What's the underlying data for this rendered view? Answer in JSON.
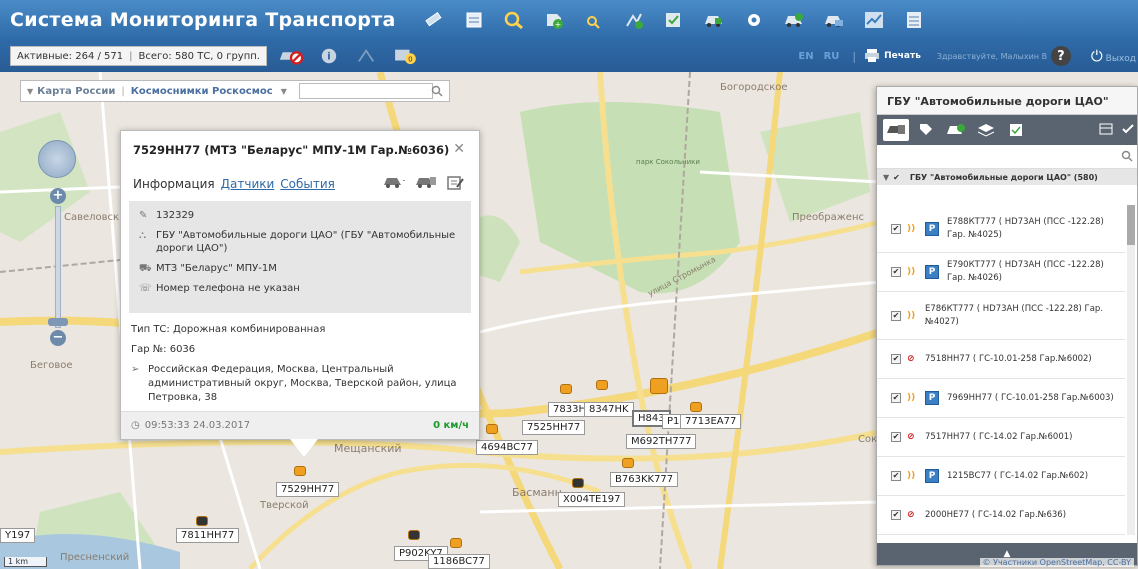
{
  "header": {
    "title": "Система Мониторинга Транспорта"
  },
  "toolbar": {
    "active_label": "Активные: 264 / 571",
    "total_label": "Всего: 580 ТС, 0 групп.",
    "lang_en": "EN",
    "lang_ru": "RU",
    "print_label": "Печать",
    "user_label": "Здравствуйте, Малыхин В.",
    "help_label": "?",
    "exit_label": "Выход"
  },
  "map": {
    "layer_primary": "Карта России",
    "layer_secondary": "Космоснимки Роскосмос",
    "search_placeholder": "",
    "labels": {
      "bogorodskoe": "Богородское",
      "savelovsk": "Савеловск",
      "preobrazhen": "Преображенс",
      "park": "парк Сокольники",
      "street": "улица Стромынка",
      "begovoe": "Беговое",
      "meshchansky": "Мещанский",
      "basmanny": "Басманн",
      "tverskoy": "Тверской",
      "presnensky": "Пресненский",
      "sok": "Сок"
    },
    "vehicles": {
      "v1": "7529HH77",
      "v2": "7811HH77",
      "v3": "4694BC77",
      "v4": "7525HH77",
      "v5": "7833H",
      "v6": "8347HK",
      "v7": "H843",
      "v8": "P1",
      "v9": "7713EA77",
      "v10": "M692TH777",
      "v11": "B763KK777",
      "v12": "X004TE197",
      "v13": "P902KY7",
      "v14": "1186BC77",
      "v15": "Y197"
    },
    "scale": "1 km",
    "attribution": "© Участники OpenStreetMap, CC-BY"
  },
  "popup": {
    "title": "7529НН77 (МТЗ \"Беларус\" МПУ-1М Гар.№6036)",
    "tab_info": "Информация",
    "tab_sensors": "Датчики",
    "tab_events": "События",
    "id_number": "132329",
    "organization": "ГБУ \"Автомобильные дороги ЦАО\" (ГБУ \"Автомобильные дороги ЦАО\")",
    "model": "МТЗ \"Беларус\" МПУ-1М",
    "phone": "Номер телефона не указан",
    "type": "Тип ТС: Дорожная комбинированная",
    "garage": "Гар №: 6036",
    "address": "Российская Федерация, Москва, Центральный административный округ, Москва, Тверской район, улица Петровка, 38",
    "timestamp": "09:53:33 24.03.2017",
    "speed": "0 км/ч"
  },
  "panel": {
    "title": "ГБУ \"Автомобильные дороги ЦАО\"",
    "search_placeholder": "",
    "group_label": "ГБУ \"Автомобильные дороги ЦАО\" (580)",
    "vehicles": [
      {
        "text": "Е788КТ777 ( НD73АН (ПСС -122.28) Гар. №4025)",
        "status": "on",
        "badge": "P"
      },
      {
        "text": "Е790КТ777 ( НD73АН (ПСС -122.28) Гар. №4026)",
        "status": "on",
        "badge": "P"
      },
      {
        "text": "Е786КТ777 ( НD73АН (ПСС -122.28) Гар. №4027)",
        "status": "on",
        "badge": ""
      },
      {
        "text": "7518НН77 ( ГС-10.01-258 Гар.№6002)",
        "status": "off",
        "badge": ""
      },
      {
        "text": "7969НН77 ( ГС-10.01-258 Гар.№6003)",
        "status": "on",
        "badge": "P"
      },
      {
        "text": "7517НН77 ( ГС-14.02 Гар.№6001)",
        "status": "off",
        "badge": ""
      },
      {
        "text": "1215ВС77 ( ГС-14.02 Гар.№602)",
        "status": "on",
        "badge": "P"
      },
      {
        "text": "2000НЕ77 ( ГС-14.02 Гар.№636)",
        "status": "off",
        "badge": ""
      }
    ],
    "bottom_label": "▲"
  },
  "colors": {
    "header": "#3a7cbc",
    "toolbar": "#2c64a0",
    "accent": "#2f6aa8",
    "speed": "#1a9a2a",
    "vehicle": "#f0a020"
  }
}
